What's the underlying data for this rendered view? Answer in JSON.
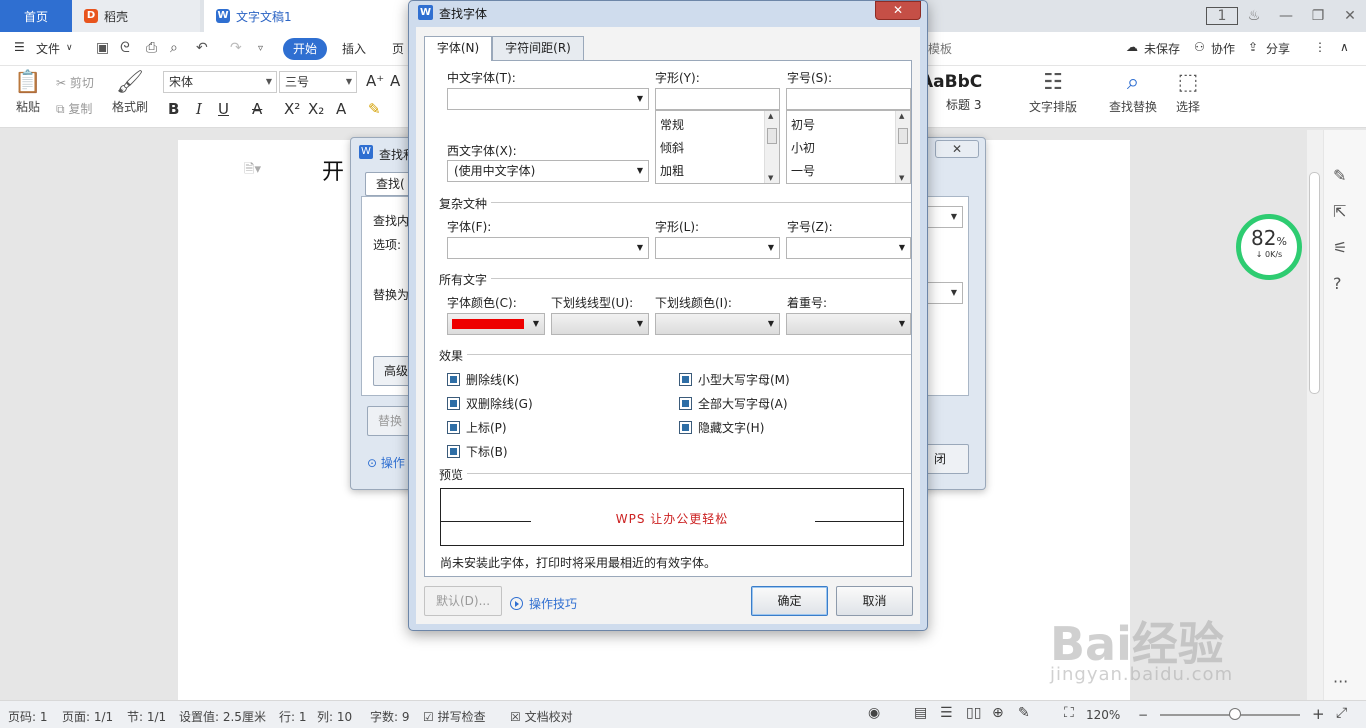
{
  "tabbar": {
    "home": "首页",
    "daoke": "稻壳",
    "doc": "文字文稿1",
    "page_badge": "1"
  },
  "menu": {
    "file": "文件",
    "start": "开始",
    "insert": "插入",
    "page_partial": "页",
    "template_partial": "模板",
    "unsaved": "未保存",
    "collab": "协作",
    "share": "分享"
  },
  "ribbon": {
    "paste": "粘贴",
    "cut": "剪切",
    "copy": "复制",
    "format_painter": "格式刷",
    "font_name": "宋体",
    "font_size": "三号",
    "style_sample": "AaBbC",
    "style_name": "标题 3",
    "text_layout": "文字排版",
    "find_replace": "查找替换",
    "select": "选择"
  },
  "document": {
    "text_visible": "开"
  },
  "speed": {
    "percent": "82",
    "percent_unit": "%",
    "rate": "0K/s"
  },
  "background_dialog": {
    "title_partial": "查找和",
    "tab_partial": "查找(",
    "find_label_partial": "查找内",
    "options_label": "选项:",
    "replace_label_partial": "替换为",
    "advanced_partial": "高级",
    "replace_btn_partial": "替换",
    "tips_partial": "操作",
    "close_partial": "闭"
  },
  "font_dialog": {
    "title": "查找字体",
    "tabs": [
      "字体(N)",
      "字符间距(R)"
    ],
    "chinese_font_label": "中文字体(T):",
    "style_label": "字形(Y):",
    "size_label": "字号(S):",
    "western_font_label": "西文字体(X):",
    "western_font_value": "(使用中文字体)",
    "style_items": [
      "常规",
      "倾斜",
      "加粗"
    ],
    "size_items": [
      "初号",
      "小初",
      "一号"
    ],
    "complex_section": "复杂文种",
    "complex_font_label": "字体(F):",
    "complex_style_label": "字形(L):",
    "complex_size_label": "字号(Z):",
    "all_text_section": "所有文字",
    "font_color_label": "字体颜色(C):",
    "underline_type_label": "下划线线型(U):",
    "underline_color_label": "下划线颜色(I):",
    "emphasis_label": "着重号:",
    "effects_section": "效果",
    "effects_left": [
      "删除线(K)",
      "双删除线(G)",
      "上标(P)",
      "下标(B)"
    ],
    "effects_right": [
      "小型大写字母(M)",
      "全部大写字母(A)",
      "隐藏文字(H)"
    ],
    "preview_section": "预览",
    "preview_text": "WPS 让办公更轻松",
    "note": "尚未安装此字体，打印时将采用最相近的有效字体。",
    "default_btn": "默认(D)...",
    "tips_link": "操作技巧",
    "ok_btn": "确定",
    "cancel_btn": "取消"
  },
  "statusbar": {
    "page_num": "页码: 1",
    "pages": "页面: 1/1",
    "section": "节: 1/1",
    "setting": "设置值: 2.5厘米",
    "row": "行: 1",
    "col": "列: 10",
    "word_count": "字数: 9",
    "spell_check": "拼写检查",
    "doc_proof": "文档校对",
    "zoom": "120%"
  },
  "watermark": {
    "brand": "Bai经验",
    "url": "jingyan.baidu.com"
  },
  "colors": {
    "accent": "#2f6fd1",
    "font_color_swatch": "#ee0000",
    "preview_text": "#cc2222",
    "speed_ring": "#2ecc71"
  }
}
